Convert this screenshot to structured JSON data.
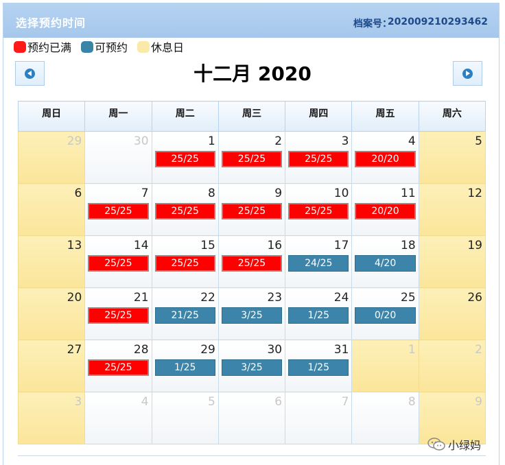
{
  "header": {
    "title": "选择预约时间",
    "file_label": "档案号：",
    "file_value": "202009210293462"
  },
  "legend": [
    {
      "label": "预约已满",
      "type": "full"
    },
    {
      "label": "可预约",
      "type": "avail"
    },
    {
      "label": "休息日",
      "type": "rest"
    }
  ],
  "colors": {
    "full": "#ff0000",
    "available": "#3c84a9",
    "rest": "#fbe9a9",
    "header": "#a6c8ec"
  },
  "nav": {
    "prev_icon": "chevron-left-icon",
    "next_icon": "chevron-right-icon"
  },
  "month_title": "十二月 2020",
  "weekdays": [
    "周日",
    "周一",
    "周二",
    "周三",
    "周四",
    "周五",
    "周六"
  ],
  "weeks": [
    [
      {
        "day": "29",
        "other": true,
        "weekend": true
      },
      {
        "day": "30",
        "other": true
      },
      {
        "day": "1",
        "slot": "25/25",
        "status": "full"
      },
      {
        "day": "2",
        "slot": "25/25",
        "status": "full"
      },
      {
        "day": "3",
        "slot": "25/25",
        "status": "full"
      },
      {
        "day": "4",
        "slot": "20/20",
        "status": "full"
      },
      {
        "day": "5",
        "weekend": true
      }
    ],
    [
      {
        "day": "6",
        "weekend": true
      },
      {
        "day": "7",
        "slot": "25/25",
        "status": "full"
      },
      {
        "day": "8",
        "slot": "25/25",
        "status": "full"
      },
      {
        "day": "9",
        "slot": "25/25",
        "status": "full"
      },
      {
        "day": "10",
        "slot": "25/25",
        "status": "full"
      },
      {
        "day": "11",
        "slot": "20/20",
        "status": "full"
      },
      {
        "day": "12",
        "weekend": true
      }
    ],
    [
      {
        "day": "13",
        "weekend": true
      },
      {
        "day": "14",
        "slot": "25/25",
        "status": "full"
      },
      {
        "day": "15",
        "slot": "25/25",
        "status": "full"
      },
      {
        "day": "16",
        "slot": "25/25",
        "status": "full"
      },
      {
        "day": "17",
        "slot": "24/25",
        "status": "avail"
      },
      {
        "day": "18",
        "slot": "4/20",
        "status": "avail"
      },
      {
        "day": "19",
        "weekend": true
      }
    ],
    [
      {
        "day": "20",
        "weekend": true
      },
      {
        "day": "21",
        "slot": "25/25",
        "status": "full"
      },
      {
        "day": "22",
        "slot": "21/25",
        "status": "avail"
      },
      {
        "day": "23",
        "slot": "3/25",
        "status": "avail"
      },
      {
        "day": "24",
        "slot": "1/25",
        "status": "avail"
      },
      {
        "day": "25",
        "slot": "0/20",
        "status": "avail"
      },
      {
        "day": "26",
        "weekend": true
      }
    ],
    [
      {
        "day": "27",
        "weekend": true
      },
      {
        "day": "28",
        "slot": "25/25",
        "status": "full"
      },
      {
        "day": "29",
        "slot": "1/25",
        "status": "avail"
      },
      {
        "day": "30",
        "slot": "3/25",
        "status": "avail"
      },
      {
        "day": "31",
        "slot": "1/25",
        "status": "avail"
      },
      {
        "day": "1",
        "other": true,
        "weekend": true
      },
      {
        "day": "2",
        "other": true,
        "weekend": true
      }
    ],
    [
      {
        "day": "3",
        "other": true,
        "weekend": true
      },
      {
        "day": "4",
        "other": true
      },
      {
        "day": "5",
        "other": true
      },
      {
        "day": "6",
        "other": true
      },
      {
        "day": "7",
        "other": true
      },
      {
        "day": "8",
        "other": true
      },
      {
        "day": "9",
        "other": true,
        "weekend": true
      }
    ]
  ],
  "watermark": {
    "icon": "wechat-icon",
    "text": "小绿妈"
  }
}
